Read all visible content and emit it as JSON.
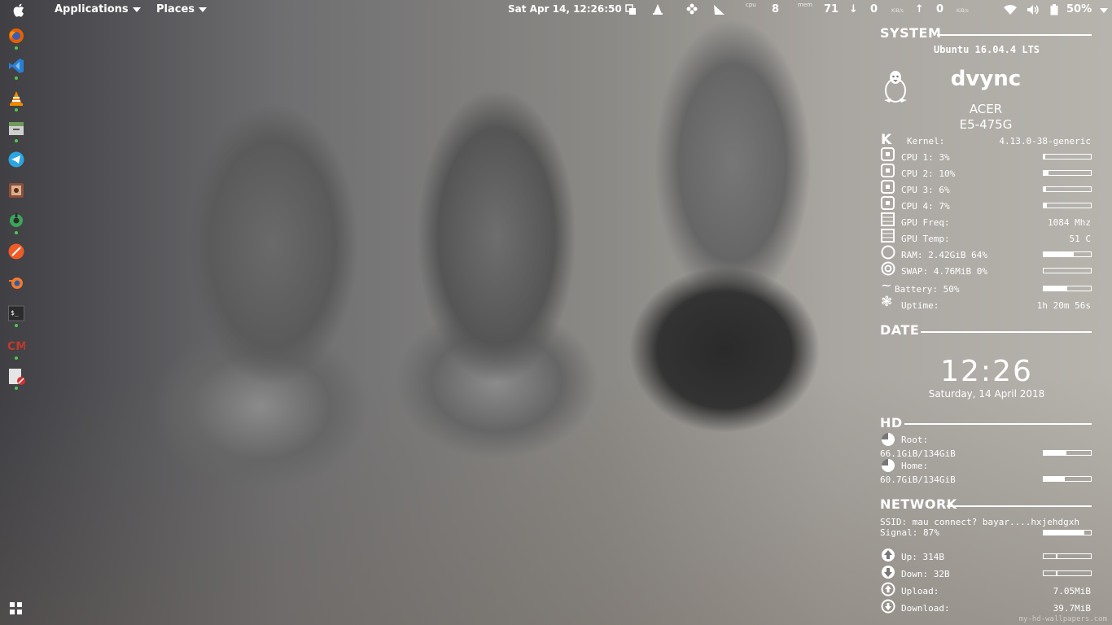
{
  "topbar": {
    "applications": "Applications",
    "places": "Places",
    "datetime": "Sat Apr 14, 12:26:50",
    "cpu_label": "cpu",
    "cpu_value": "8",
    "mem_label": "mem",
    "mem_value": "71",
    "down_arrow": "↓",
    "down_value": "0",
    "down_unit": "KiB/s",
    "up_arrow": "↑",
    "up_value": "0",
    "up_unit": "KiB/s",
    "battery": "50%"
  },
  "dock": {
    "apps": [
      {
        "name": "firefox",
        "color": "#e66000"
      },
      {
        "name": "vscode",
        "color": "#2a7fd4"
      },
      {
        "name": "vlc",
        "color": "#f08a00"
      },
      {
        "name": "files",
        "color": "#6f9a5a"
      },
      {
        "name": "telegram",
        "color": "#2ca5e0"
      },
      {
        "name": "image-viewer",
        "color": "#8a4f3c"
      },
      {
        "name": "settings",
        "color": "#3aa65a"
      },
      {
        "name": "postman",
        "color": "#ef5b25"
      },
      {
        "name": "blender",
        "color": "#f5792a"
      },
      {
        "name": "terminal",
        "color": "#2b2b2b"
      },
      {
        "name": "cm",
        "color": "#c0392b"
      },
      {
        "name": "text-editor",
        "color": "#dddddd"
      }
    ]
  },
  "system": {
    "header": "SYSTEM",
    "os": "Ubuntu 16.04.4 LTS",
    "hostname": "dvync",
    "brand": "ACER",
    "model": "E5-475G",
    "kernel_label": "Kernel:",
    "kernel_value": "4.13.0-38-generic",
    "cpus": [
      {
        "label": "CPU 1: 3%",
        "percent": 3
      },
      {
        "label": "CPU 2: 10%",
        "percent": 10
      },
      {
        "label": "CPU 3: 6%",
        "percent": 6
      },
      {
        "label": "CPU 4: 7%",
        "percent": 7
      }
    ],
    "gpu_freq_label": "GPU Freq:",
    "gpu_freq_value": "1084 Mhz",
    "gpu_temp_label": "GPU Temp:",
    "gpu_temp_value": "51 C",
    "ram_label": "RAM: 2.42GiB 64%",
    "ram_percent": 64,
    "swap_label": "SWAP: 4.76MiB 0%",
    "swap_percent": 0,
    "battery_label": "Battery: 50%",
    "battery_percent": 50,
    "uptime_label": "Uptime:",
    "uptime_value": "1h 20m 56s"
  },
  "date": {
    "header": "DATE",
    "time": "12:26",
    "full": "Saturday, 14 April 2018"
  },
  "hd": {
    "header": "HD",
    "root_label": "Root:",
    "root_value": "66.1GiB/134GiB",
    "root_percent": 49,
    "home_label": "Home:",
    "home_value": "60.7GiB/134GiB",
    "home_percent": 45
  },
  "network": {
    "header": "NETWORK",
    "ssid": "SSID: mau connect? bayar....hxjehdgxh",
    "signal_label": "Signal: 87%",
    "signal_percent": 87,
    "up_label": "Up: 314B",
    "up_percent": 25,
    "down_label": "Down: 32B",
    "down_percent": 25,
    "upload_label": "Upload:",
    "upload_value": "7.05MiB",
    "download_label": "Download:",
    "download_value": "39.7MiB"
  },
  "watermark": "my-hd-wallpapers.com"
}
